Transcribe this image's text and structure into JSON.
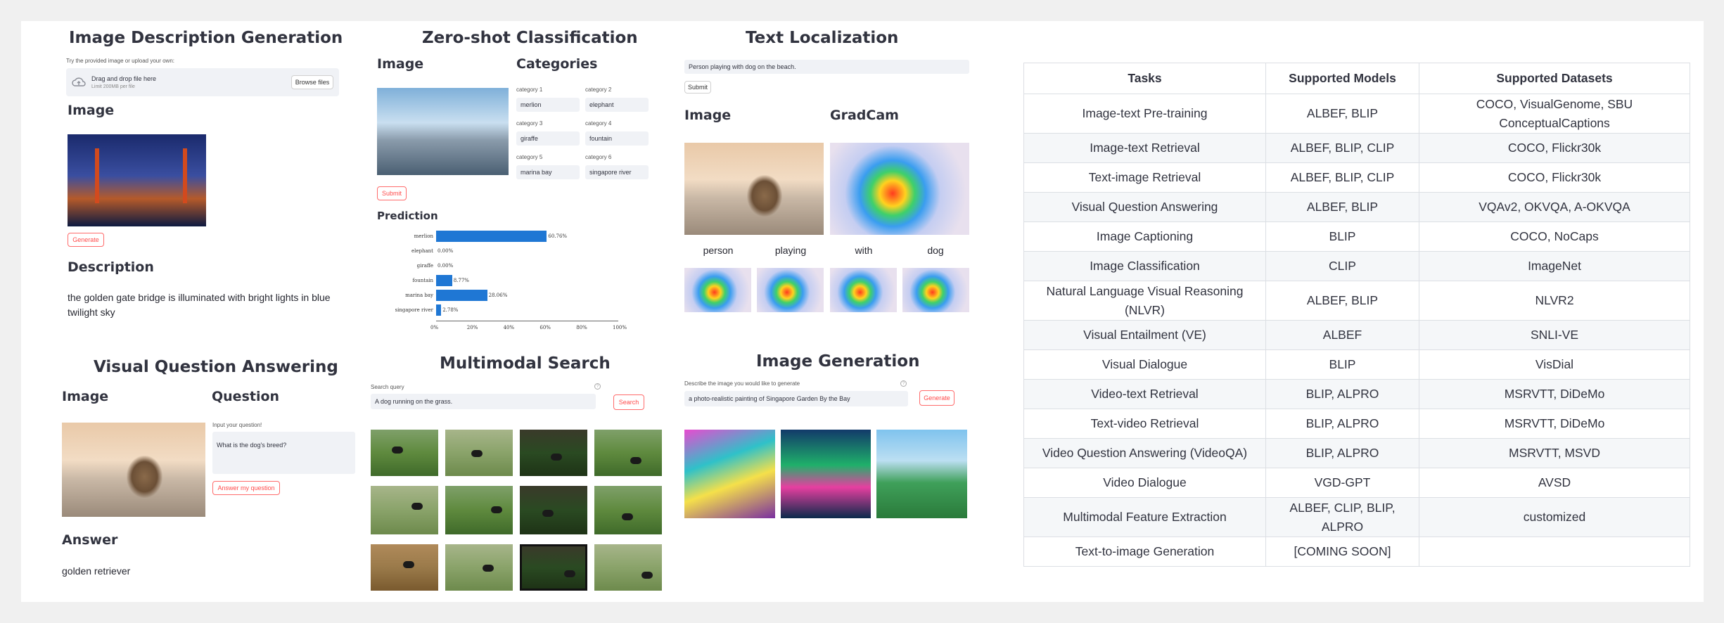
{
  "panels": {
    "caption": {
      "title": "Image Description Generation",
      "hint": "Try the provided image or upload your own:",
      "drop_text": "Drag and drop file here",
      "limit_text": "Limit 200MB per file",
      "browse_label": "Browse files",
      "image_label": "Image",
      "generate_label": "Generate",
      "description_label": "Description",
      "description_text": "the golden gate bridge is illuminated with bright lights in blue twilight sky"
    },
    "vqa": {
      "title": "Visual Question Answering",
      "image_label": "Image",
      "question_label": "Question",
      "input_hint": "Input your question!",
      "question_value": "What is the dog's breed?",
      "answer_button": "Answer my question",
      "answer_label": "Answer",
      "answer_text": "golden retriever"
    },
    "zeroshot": {
      "title": "Zero-shot Classification",
      "image_label": "Image",
      "categories_label": "Categories",
      "categories": [
        {
          "label": "category 1",
          "value": "merlion"
        },
        {
          "label": "category 2",
          "value": "elephant"
        },
        {
          "label": "category 3",
          "value": "giraffe"
        },
        {
          "label": "category 4",
          "value": "fountain"
        },
        {
          "label": "category 5",
          "value": "marina bay"
        },
        {
          "label": "category 6",
          "value": "singapore river"
        }
      ],
      "submit_label": "Submit",
      "prediction_label": "Prediction"
    },
    "search": {
      "title": "Multimodal Search",
      "query_label": "Search query",
      "query_value": "A dog running on the grass.",
      "search_label": "Search"
    },
    "localization": {
      "title": "Text Localization",
      "text_value": "Person playing with dog on the beach.",
      "submit_label": "Submit",
      "image_label": "Image",
      "gradcam_label": "GradCam",
      "words": [
        "person",
        "playing",
        "with",
        "dog"
      ]
    },
    "generation": {
      "title": "Image Generation",
      "prompt_label": "Describe the image you would like to generate",
      "prompt_value": "a photo-realistic painting of Singapore Garden By the Bay",
      "generate_label": "Generate"
    }
  },
  "chart_data": {
    "type": "bar",
    "orientation": "horizontal",
    "categories": [
      "merlion",
      "elephant",
      "giraffe",
      "fountain",
      "marina bay",
      "singapore river"
    ],
    "values": [
      60.76,
      0.0,
      0.0,
      8.77,
      28.06,
      2.78
    ],
    "value_labels": [
      "60.76%",
      "0.00%",
      "0.00%",
      "8.77%",
      "28.06%",
      "2.78%"
    ],
    "xlim": [
      0,
      100
    ],
    "xticks": [
      "0%",
      "20%",
      "40%",
      "60%",
      "80%",
      "100%"
    ],
    "bar_color": "#1f77d4"
  },
  "table": {
    "headers": [
      "Tasks",
      "Supported Models",
      "Supported Datasets"
    ],
    "rows": [
      [
        "Image-text Pre-training",
        "ALBEF, BLIP",
        "COCO, VisualGenome, SBU ConceptualCaptions"
      ],
      [
        "Image-text Retrieval",
        "ALBEF, BLIP, CLIP",
        "COCO, Flickr30k"
      ],
      [
        "Text-image Retrieval",
        "ALBEF, BLIP, CLIP",
        "COCO, Flickr30k"
      ],
      [
        "Visual Question Answering",
        "ALBEF, BLIP",
        "VQAv2, OKVQA, A-OKVQA"
      ],
      [
        "Image Captioning",
        "BLIP",
        "COCO, NoCaps"
      ],
      [
        "Image Classification",
        "CLIP",
        "ImageNet"
      ],
      [
        "Natural Language Visual Reasoning (NLVR)",
        "ALBEF, BLIP",
        "NLVR2"
      ],
      [
        "Visual Entailment (VE)",
        "ALBEF",
        "SNLI-VE"
      ],
      [
        "Visual Dialogue",
        "BLIP",
        "VisDial"
      ],
      [
        "Video-text Retrieval",
        "BLIP, ALPRO",
        "MSRVTT, DiDeMo"
      ],
      [
        "Text-video Retrieval",
        "BLIP, ALPRO",
        "MSRVTT, DiDeMo"
      ],
      [
        "Video Question Answering (VideoQA)",
        "BLIP, ALPRO",
        "MSRVTT, MSVD"
      ],
      [
        "Video Dialogue",
        "VGD-GPT",
        "AVSD"
      ],
      [
        "Multimodal Feature Extraction",
        "ALBEF, CLIP, BLIP, ALPRO",
        "customized"
      ],
      [
        "Text-to-image Generation",
        "[COMING SOON]",
        ""
      ]
    ]
  },
  "colors": {
    "accent": "#ff4b4b",
    "input_bg": "#f0f2f6",
    "bar": "#1f77d4"
  }
}
